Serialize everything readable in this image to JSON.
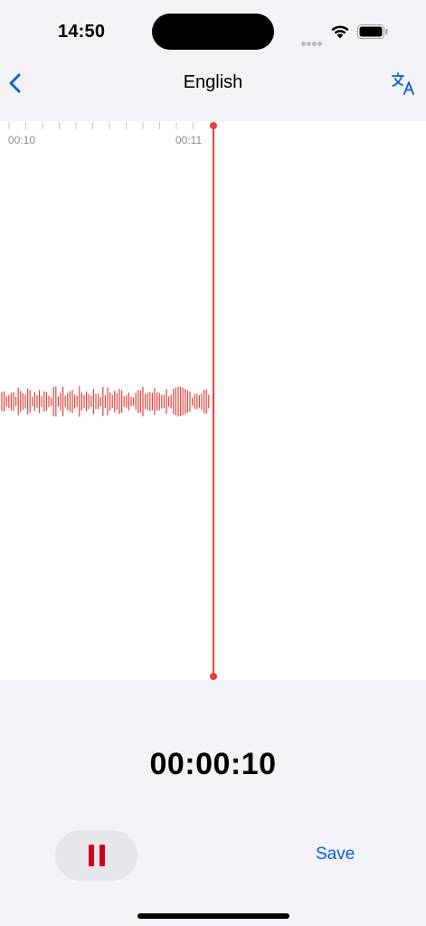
{
  "status_bar": {
    "time": "14:50",
    "icons": [
      "cellular-signal-icon",
      "wifi-icon",
      "battery-icon"
    ]
  },
  "nav": {
    "title": "English",
    "back_icon": "chevron-left-icon",
    "translate_icon": "translate-icon"
  },
  "waveform": {
    "tick_labels": [
      "00:10",
      "00:11"
    ],
    "playhead_color": "#e5413a",
    "wave_color": "#e5413a"
  },
  "recorder": {
    "elapsed": "00:00:10",
    "pause_icon": "pause-icon",
    "save_label": "Save"
  },
  "colors": {
    "accent": "#0a62d4",
    "record_red": "#d0021b",
    "background": "#f2f2f7"
  }
}
